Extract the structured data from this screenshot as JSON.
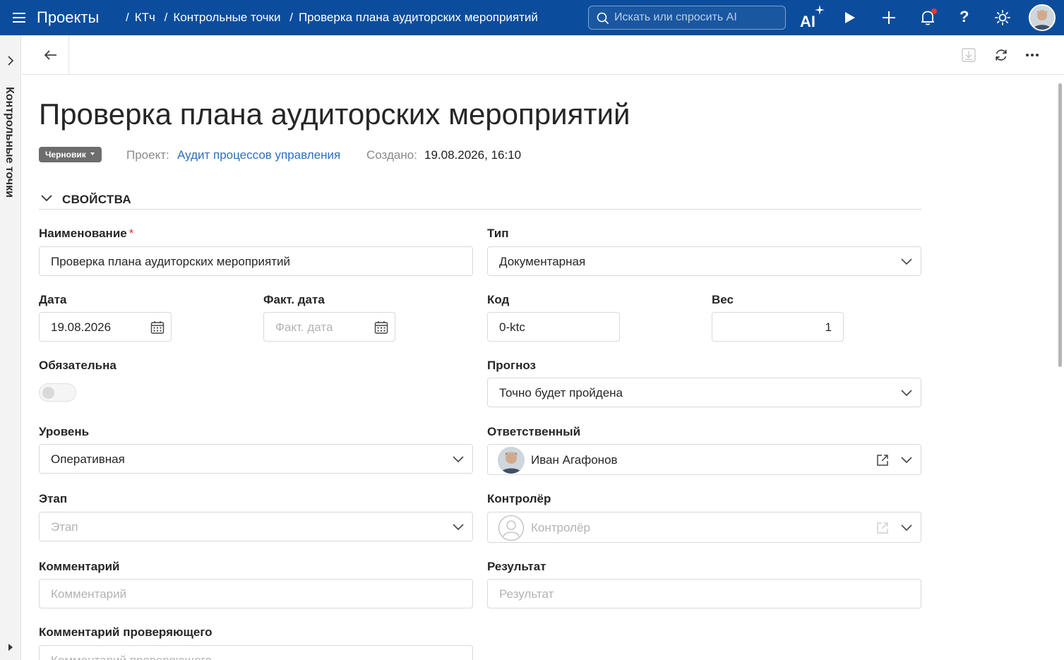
{
  "topbar": {
    "app_title": "Проекты",
    "breadcrumbs": [
      "КТч",
      "Контрольные точки",
      "Проверка плана аудиторских мероприятий"
    ],
    "breadcrumb_separator": "/",
    "search_placeholder": "Искать или спросить AI",
    "ai_label": "AI",
    "help_label": "?",
    "notification_dot_color": "#e53935"
  },
  "rail": {
    "label": "Контрольные точки"
  },
  "page": {
    "title": "Проверка плана аудиторских мероприятий",
    "status_badge": "Черновик",
    "project_label": "Проект:",
    "project_value": "Аудит процессов управления",
    "created_label": "Создано:",
    "created_value": "19.08.2026, 16:10"
  },
  "section": {
    "title": "СВОЙСТВА"
  },
  "form": {
    "name": {
      "label": "Наименование",
      "required_mark": "*",
      "value": "Проверка плана аудиторских мероприятий"
    },
    "type": {
      "label": "Тип",
      "value": "Документарная"
    },
    "date": {
      "label": "Дата",
      "value": "19.08.2026"
    },
    "fact_date": {
      "label": "Факт. дата",
      "placeholder": "Факт. дата"
    },
    "code": {
      "label": "Код",
      "value": "0-ktc"
    },
    "weight": {
      "label": "Вес",
      "value": "1"
    },
    "mandatory": {
      "label": "Обязательна",
      "on": false
    },
    "forecast": {
      "label": "Прогноз",
      "value": "Точно будет пройдена"
    },
    "level": {
      "label": "Уровень",
      "value": "Оперативная"
    },
    "responsible": {
      "label": "Ответственный",
      "value": "Иван Агафонов"
    },
    "stage": {
      "label": "Этап",
      "placeholder": "Этап"
    },
    "controller": {
      "label": "Контролёр",
      "placeholder": "Контролёр"
    },
    "comment": {
      "label": "Комментарий",
      "placeholder": "Комментарий"
    },
    "result": {
      "label": "Результат",
      "placeholder": "Результат"
    },
    "reviewer_comment": {
      "label": "Комментарий проверяющего",
      "placeholder": "Комментарий проверяющего"
    }
  },
  "colors": {
    "topbar": "#0b4d9c",
    "link": "#2e6fba",
    "badge": "#6d6d6d"
  }
}
